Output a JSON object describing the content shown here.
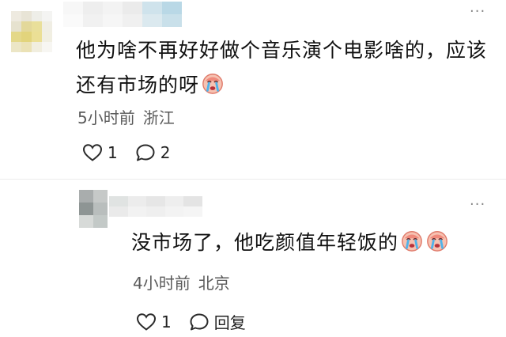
{
  "comment": {
    "text": "他为啥不再好好做个音乐演个电影啥的，应该还有市场的呀",
    "emoji": "crying-face",
    "time": "5小时前",
    "location": "浙江",
    "like_count": "1",
    "reply_count": "2",
    "more": "···"
  },
  "reply": {
    "text": "没市场了，他吃颜值年轻饭的",
    "emojis": [
      "crying-face",
      "crying-face"
    ],
    "time": "4小时前",
    "location": "北京",
    "like_count": "1",
    "reply_label": "回复",
    "more": "···"
  }
}
